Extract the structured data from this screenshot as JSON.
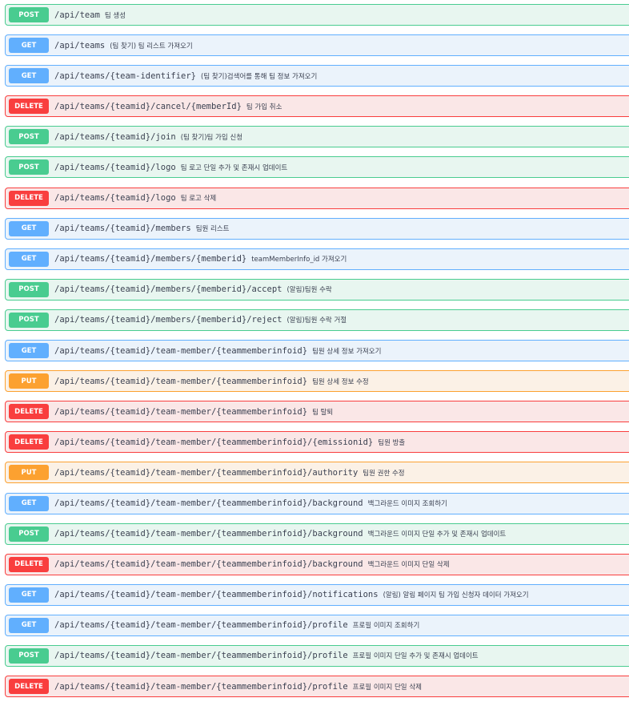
{
  "method_colors": {
    "POST": "#49cc90",
    "GET": "#61affe",
    "DELETE": "#f93e3e",
    "PUT": "#fca130"
  },
  "operations": [
    {
      "method": "POST",
      "path": "/api/team",
      "summary": "팀 생성"
    },
    {
      "method": "GET",
      "path": "/api/teams",
      "summary": "(팀 찾기) 팀 리스트 가져오기"
    },
    {
      "method": "GET",
      "path": "/api/teams/{team-identifier}",
      "summary": "(팀 찾기)검색어를 통해 팀 정보 가져오기"
    },
    {
      "method": "DELETE",
      "path": "/api/teams/{teamid}/cancel/{memberId}",
      "summary": "팀 가입 취소"
    },
    {
      "method": "POST",
      "path": "/api/teams/{teamid}/join",
      "summary": "(팀 찾기)팀 가입 신청"
    },
    {
      "method": "POST",
      "path": "/api/teams/{teamid}/logo",
      "summary": "팀 로고 단일 추가 및 존재시 업데이트"
    },
    {
      "method": "DELETE",
      "path": "/api/teams/{teamid}/logo",
      "summary": "팀 로고 삭제"
    },
    {
      "method": "GET",
      "path": "/api/teams/{teamid}/members",
      "summary": "팀원 리스트"
    },
    {
      "method": "GET",
      "path": "/api/teams/{teamid}/members/{memberid}",
      "summary": "teamMemberInfo_id 가져오기"
    },
    {
      "method": "POST",
      "path": "/api/teams/{teamid}/members/{memberid}/accept",
      "summary": "(알림)팀원 수락"
    },
    {
      "method": "POST",
      "path": "/api/teams/{teamid}/members/{memberid}/reject",
      "summary": "(알림)팀원 수락 거절"
    },
    {
      "method": "GET",
      "path": "/api/teams/{teamid}/team-member/{teammemberinfoid}",
      "summary": "팀원 상세 정보 가져오기"
    },
    {
      "method": "PUT",
      "path": "/api/teams/{teamid}/team-member/{teammemberinfoid}",
      "summary": "팀원 상세 정보 수정"
    },
    {
      "method": "DELETE",
      "path": "/api/teams/{teamid}/team-member/{teammemberinfoid}",
      "summary": "팀 탈퇴"
    },
    {
      "method": "DELETE",
      "path": "/api/teams/{teamid}/team-member/{teammemberinfoid}/{emissionid}",
      "summary": "팀원 방출"
    },
    {
      "method": "PUT",
      "path": "/api/teams/{teamid}/team-member/{teammemberinfoid}/authority",
      "summary": "팀원 권한 수정"
    },
    {
      "method": "GET",
      "path": "/api/teams/{teamid}/team-member/{teammemberinfoid}/background",
      "summary": "백그라운드 이미지 조회하기"
    },
    {
      "method": "POST",
      "path": "/api/teams/{teamid}/team-member/{teammemberinfoid}/background",
      "summary": "백그라운드 이미지 단일 추가 및 존재시 업데이트"
    },
    {
      "method": "DELETE",
      "path": "/api/teams/{teamid}/team-member/{teammemberinfoid}/background",
      "summary": "백그라운드 이미지 단일 삭제"
    },
    {
      "method": "GET",
      "path": "/api/teams/{teamid}/team-member/{teammemberinfoid}/notifications",
      "summary": "(알림) 알림 페이지 팀 가입 신청자 데이터 가져오기"
    },
    {
      "method": "GET",
      "path": "/api/teams/{teamid}/team-member/{teammemberinfoid}/profile",
      "summary": "프로필 이미지 조회하기"
    },
    {
      "method": "POST",
      "path": "/api/teams/{teamid}/team-member/{teammemberinfoid}/profile",
      "summary": "프로필 이미지 단일 추가 및 존재시 업데이트"
    },
    {
      "method": "DELETE",
      "path": "/api/teams/{teamid}/team-member/{teammemberinfoid}/profile",
      "summary": "프로필 이미지 단일 삭제"
    }
  ]
}
